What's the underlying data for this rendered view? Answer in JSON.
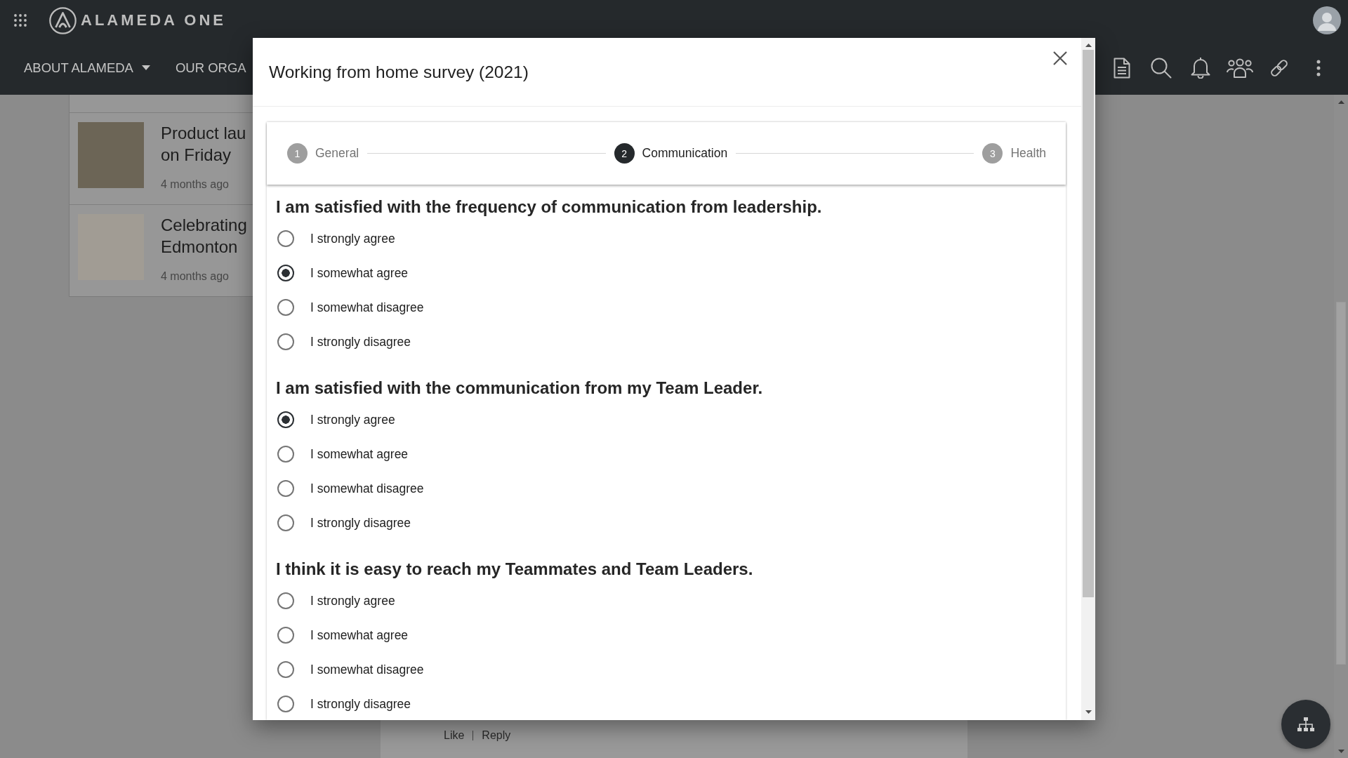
{
  "app_bar": {
    "logo_text": "ALAMEDA ONE",
    "nav": [
      {
        "label": "ABOUT ALAMEDA",
        "dropdown": true
      },
      {
        "label": "OUR ORGA",
        "dropdown": false
      }
    ]
  },
  "background": {
    "news": [
      {
        "title_lines": [
          "Product lau",
          "on Friday"
        ],
        "time": "4 months ago"
      },
      {
        "title_lines": [
          "Celebrating",
          "Edmonton"
        ],
        "time": "4 months ago"
      }
    ],
    "comment_actions": [
      "Like",
      "Reply"
    ]
  },
  "dialog": {
    "title": "Working from home survey (2021)",
    "steps": [
      {
        "number": "1",
        "label": "General",
        "selected": false
      },
      {
        "number": "2",
        "label": "Communication",
        "selected": true
      },
      {
        "number": "3",
        "label": "Health",
        "selected": false
      }
    ],
    "questions": [
      {
        "text": "I am satisfied with the frequency of communication from leadership.",
        "options": [
          {
            "label": "I strongly agree",
            "selected": false
          },
          {
            "label": "I somewhat agree",
            "selected": true
          },
          {
            "label": "I somewhat disagree",
            "selected": false
          },
          {
            "label": "I strongly disagree",
            "selected": false
          }
        ]
      },
      {
        "text": "I am satisfied with the communication from my Team Leader.",
        "options": [
          {
            "label": "I strongly agree",
            "selected": true
          },
          {
            "label": "I somewhat agree",
            "selected": false
          },
          {
            "label": "I somewhat disagree",
            "selected": false
          },
          {
            "label": "I strongly disagree",
            "selected": false
          }
        ]
      },
      {
        "text": "I think it is easy to reach my Teammates and Team Leaders.",
        "options": [
          {
            "label": "I strongly agree",
            "selected": false
          },
          {
            "label": "I somewhat agree",
            "selected": false
          },
          {
            "label": "I somewhat disagree",
            "selected": false
          },
          {
            "label": "I strongly disagree",
            "selected": false
          }
        ]
      }
    ]
  }
}
